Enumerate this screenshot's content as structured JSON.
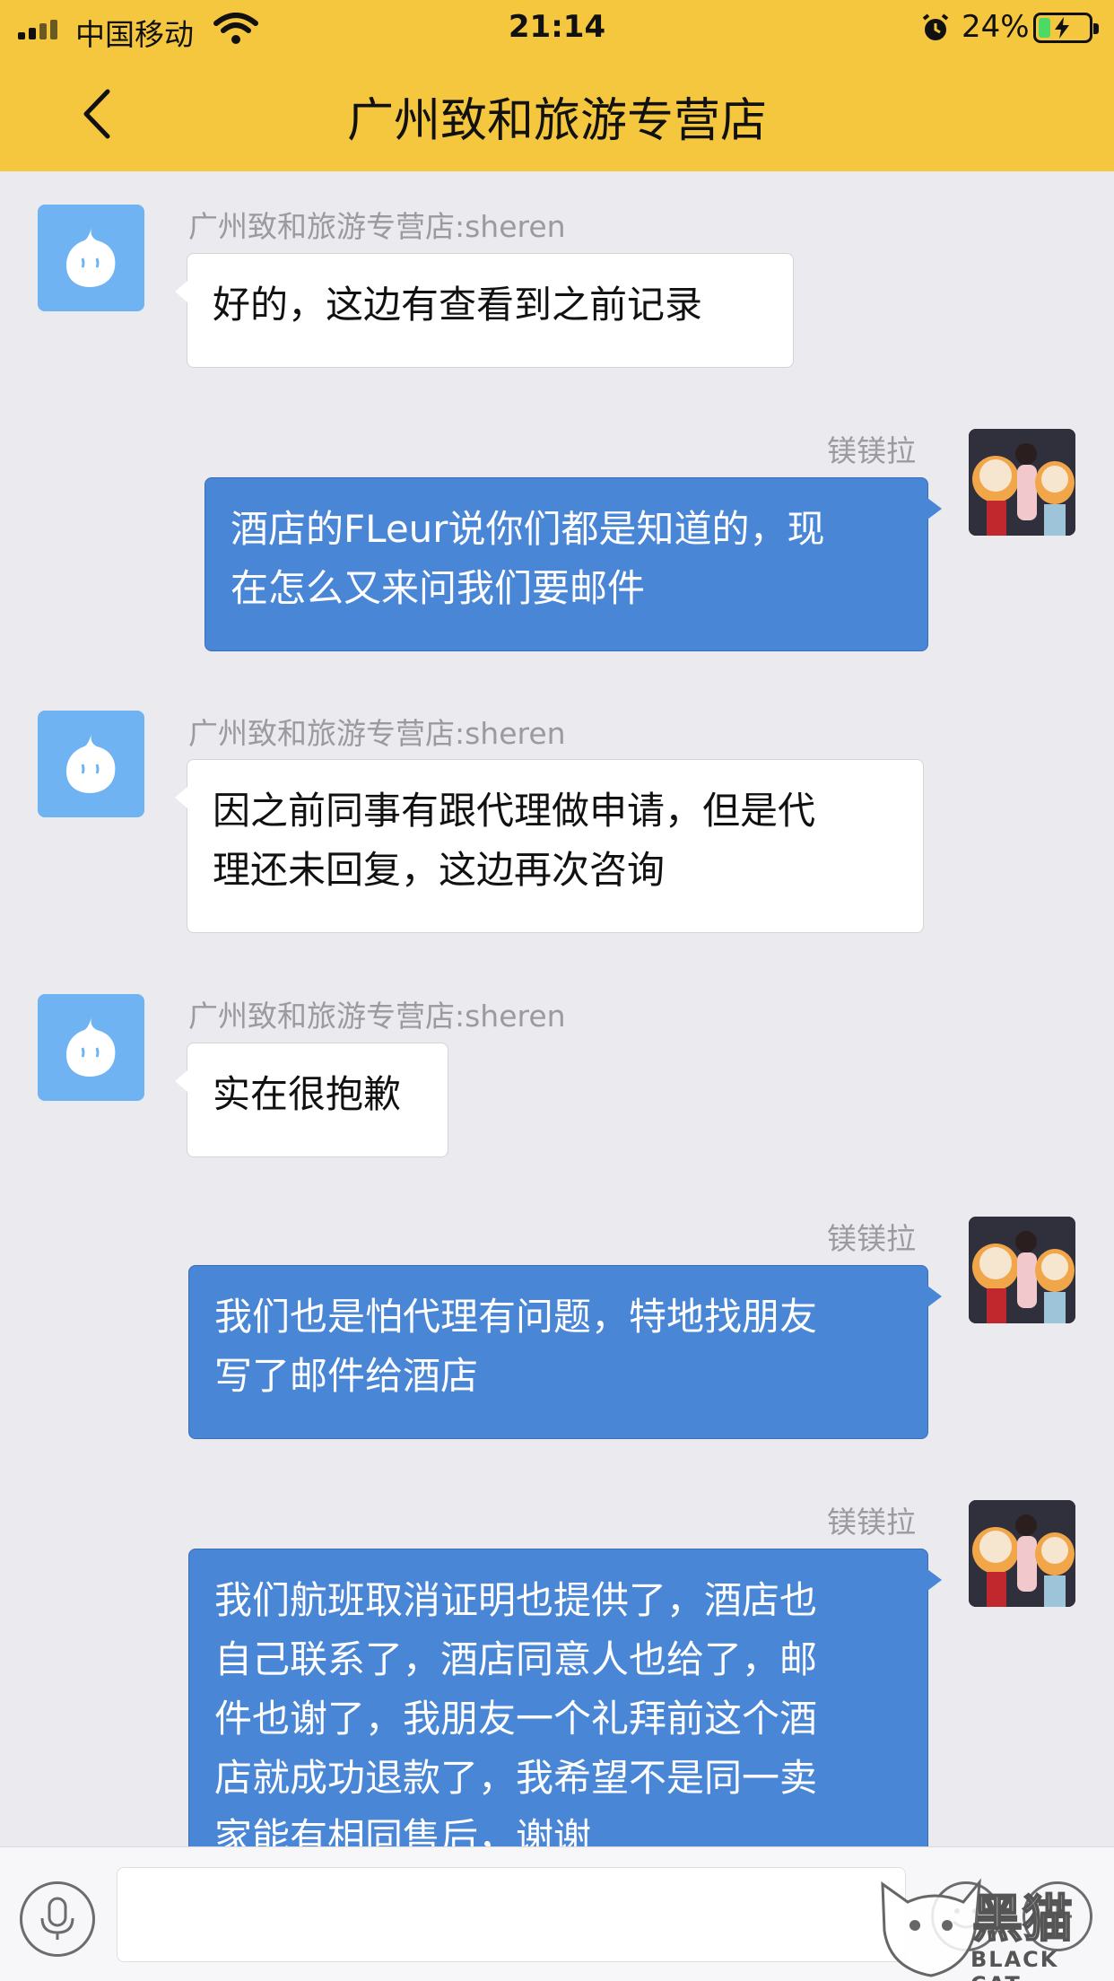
{
  "status_bar": {
    "carrier": "中国移动",
    "time": "21:14",
    "battery_percent": "24%",
    "battery_level": 0.24
  },
  "header": {
    "title": "广州致和旅游专营店"
  },
  "messages": [
    {
      "side": "in",
      "sender": "广州致和旅游专营店:sheren",
      "text": "好的，这边有查看到之前记录"
    },
    {
      "side": "out",
      "sender": "镁镁拉",
      "lines": [
        "酒店的FLeur说你们都是知道的，现",
        "在怎么又来问我们要邮件"
      ]
    },
    {
      "side": "in",
      "sender": "广州致和旅游专营店:sheren",
      "lines": [
        "因之前同事有跟代理做申请，但是代",
        "理还未回复，这边再次咨询"
      ]
    },
    {
      "side": "in",
      "sender": "广州致和旅游专营店:sheren",
      "text": "实在很抱歉"
    },
    {
      "side": "out",
      "sender": "镁镁拉",
      "lines": [
        "我们也是怕代理有问题，特地找朋友",
        "写了邮件给酒店"
      ]
    },
    {
      "side": "out",
      "sender": "镁镁拉",
      "lines": [
        "我们航班取消证明也提供了，酒店也",
        "自己联系了，酒店同意人也给了，邮",
        "件也谢了，我朋友一个礼拜前这个酒",
        "店就成功退款了，我希望不是同一卖",
        "家能有相同售后，谢谢"
      ]
    }
  ],
  "input_bar": {
    "value": "",
    "icons": [
      "microphone-icon",
      "emoji-icon",
      "plus-icon"
    ]
  },
  "watermark": {
    "text": "黑猫",
    "sub": "BLACK CAT"
  },
  "colors": {
    "header": "#f5c73f",
    "background": "#ebebef",
    "out_bubble": "#4a86d6",
    "in_bubble": "#ffffff",
    "bot_avatar": "#6fb3f3"
  }
}
